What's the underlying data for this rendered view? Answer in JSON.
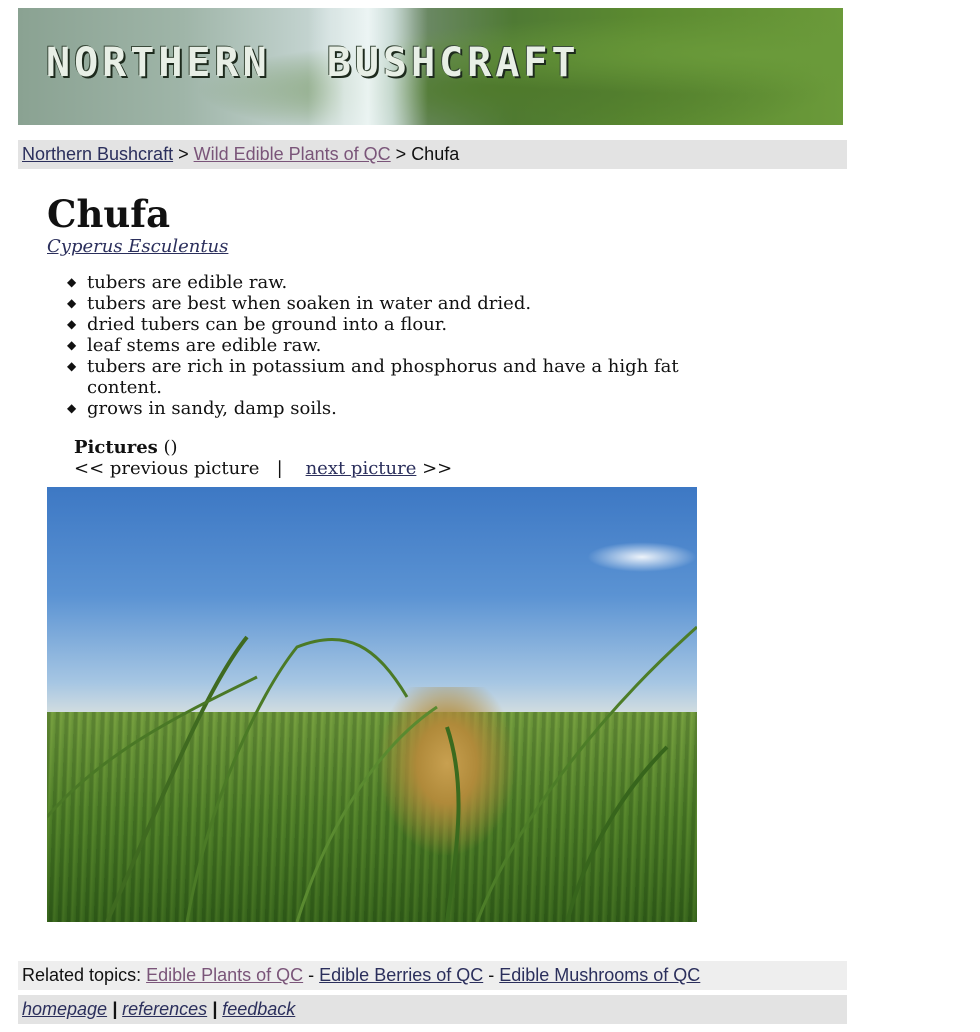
{
  "header": {
    "banner_title": "NORTHERN  BUSHCRAFT"
  },
  "breadcrumb": {
    "home": "Northern Bushcraft",
    "sep1": " > ",
    "section": "Wild Edible Plants of QC",
    "sep2": " > ",
    "current": "Chufa"
  },
  "plant": {
    "name": "Chufa",
    "scientific": "Cyperus Esculentus",
    "facts": [
      "tubers are edible raw.",
      "tubers are best when soaken in water and dried.",
      "dried tubers can be ground into a flour.",
      "leaf stems are edible raw.",
      "tubers are rich in potassium and phosphorus and have a high fat content.",
      "grows in sandy, damp soils."
    ]
  },
  "pictures": {
    "label": "Pictures",
    "count": " ()",
    "prev": "<< previous picture",
    "divider": "|",
    "next": "next picture",
    "next_arrows": " >>"
  },
  "related": {
    "label": "Related topics: ",
    "links": [
      "Edible Plants of QC",
      "Edible Berries of QC",
      "Edible Mushrooms of QC"
    ],
    "sep": " - "
  },
  "footer": {
    "links": [
      "homepage",
      "references",
      "feedback"
    ],
    "sep": " | "
  }
}
